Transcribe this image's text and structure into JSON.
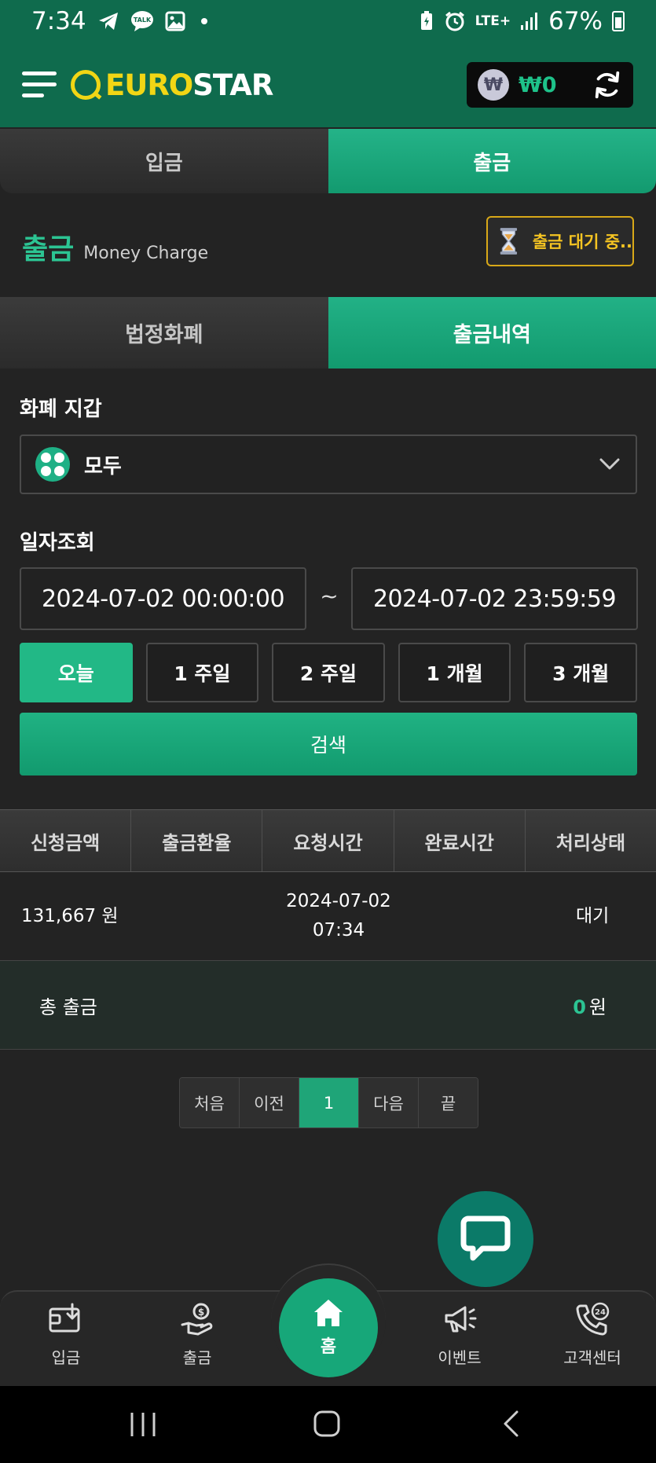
{
  "status_bar": {
    "time": "7:34",
    "network": "LTE+",
    "battery": "67%"
  },
  "header": {
    "logo_part1": "EURO",
    "logo_part2": "STAR",
    "balance_symbol": "₩",
    "balance": "₩0"
  },
  "main_tabs": [
    {
      "label": "입금",
      "active": false
    },
    {
      "label": "출금",
      "active": true
    }
  ],
  "section": {
    "title": "출금",
    "subtitle": "Money Charge",
    "pending_label": "출금 대기 중.."
  },
  "sub_tabs": [
    {
      "label": "법정화폐",
      "active": false
    },
    {
      "label": "출금내역",
      "active": true
    }
  ],
  "wallet": {
    "label": "화폐 지갑",
    "selected": "모두"
  },
  "date_search": {
    "label": "일자조회",
    "start": "2024-07-02 00:00:00",
    "separator": "~",
    "end": "2024-07-02 23:59:59",
    "periods": [
      "오늘",
      "1 주일",
      "2 주일",
      "1 개월",
      "3 개월"
    ],
    "active_period": "오늘",
    "search_label": "검색"
  },
  "table": {
    "headers": [
      "신청금액",
      "출금환율",
      "요청시간",
      "완료시간",
      "처리상태"
    ],
    "rows": [
      {
        "amount": "131,667 원",
        "rate": "",
        "request_date": "2024-07-02",
        "request_time": "07:34",
        "complete": "",
        "status": "대기"
      }
    ]
  },
  "total": {
    "label": "총 출금",
    "value": "0",
    "unit": "원"
  },
  "pagination": {
    "first": "처음",
    "prev": "이전",
    "current": "1",
    "next": "다음",
    "last": "끝"
  },
  "bottom_nav": {
    "deposit": "입금",
    "withdraw": "출금",
    "home": "홈",
    "event": "이벤트",
    "support": "고객센터"
  },
  "colors": {
    "brand_green": "#1eb085",
    "header_green": "#0f6b4d",
    "logo_yellow": "#f1d615",
    "pending_yellow": "#f5c422"
  }
}
